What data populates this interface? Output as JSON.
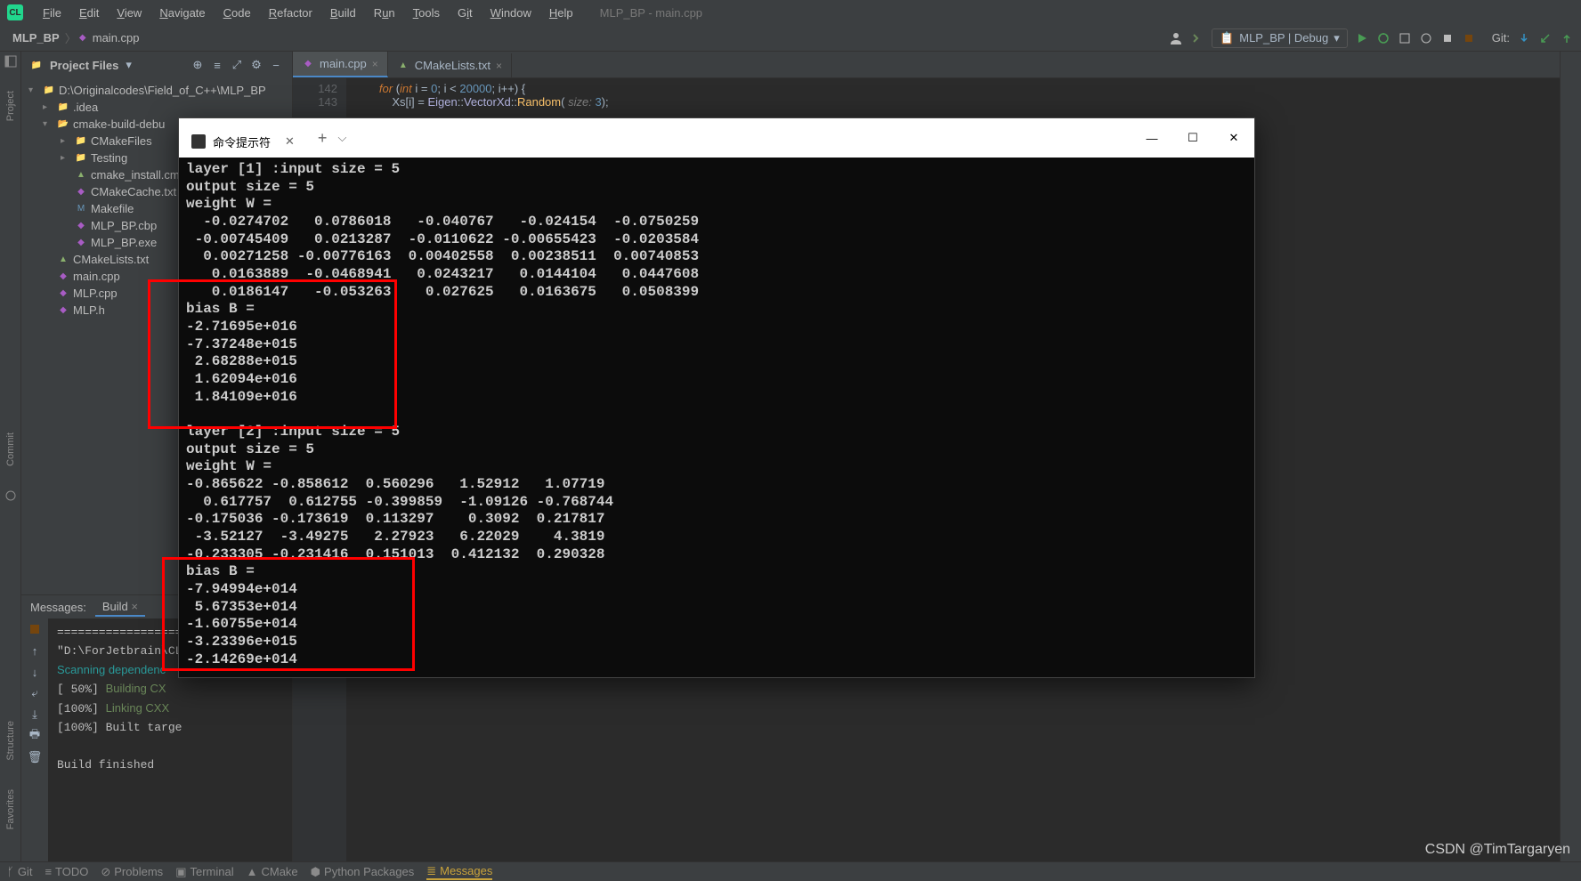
{
  "window": {
    "title": "MLP_BP - main.cpp"
  },
  "menu": {
    "file": "File",
    "edit": "Edit",
    "view": "View",
    "navigate": "Navigate",
    "code": "Code",
    "refactor": "Refactor",
    "build": "Build",
    "run": "Run",
    "tools": "Tools",
    "git": "Git",
    "window": "Window",
    "help": "Help"
  },
  "breadcrumb": {
    "project": "MLP_BP",
    "file": "main.cpp"
  },
  "runconfig": {
    "label": "MLP_BP | Debug"
  },
  "toolbar_right": {
    "git": "Git:"
  },
  "project_panel": {
    "title": "Project Files",
    "root": "D:\\Originalcodes\\Field_of_C++\\MLP_BP",
    "items": [
      {
        "name": ".idea",
        "type": "folder",
        "indent": 1,
        "arrow": "▸"
      },
      {
        "name": "cmake-build-debu",
        "type": "folder-o",
        "indent": 1,
        "arrow": "▾"
      },
      {
        "name": "CMakeFiles",
        "type": "folder",
        "indent": 2,
        "arrow": "▸"
      },
      {
        "name": "Testing",
        "type": "folder",
        "indent": 2,
        "arrow": "▸"
      },
      {
        "name": "cmake_install.cm",
        "type": "cmake",
        "indent": 2
      },
      {
        "name": "CMakeCache.txt",
        "type": "file-p",
        "indent": 2
      },
      {
        "name": "Makefile",
        "type": "file-b",
        "indent": 2
      },
      {
        "name": "MLP_BP.cbp",
        "type": "file-p",
        "indent": 2
      },
      {
        "name": "MLP_BP.exe",
        "type": "file-p",
        "indent": 2
      },
      {
        "name": "CMakeLists.txt",
        "type": "cmake",
        "indent": 1
      },
      {
        "name": "main.cpp",
        "type": "file-p",
        "indent": 1
      },
      {
        "name": "MLP.cpp",
        "type": "file-p",
        "indent": 1
      },
      {
        "name": "MLP.h",
        "type": "file-p",
        "indent": 1
      }
    ]
  },
  "editor": {
    "tabs": [
      {
        "name": "main.cpp",
        "active": true,
        "icon": "cpp"
      },
      {
        "name": "CMakeLists.txt",
        "active": false,
        "icon": "cmake"
      }
    ],
    "lines": [
      {
        "n": "142",
        "code": "for (int i = 0; i < 20000; i++) {"
      },
      {
        "n": "143",
        "code": "    Xs[i] = Eigen::VectorXd::Random( size: 3);"
      }
    ]
  },
  "messages": {
    "label": "Messages:",
    "tab": "Build",
    "lines": [
      "====================",
      "\"D:\\ForJetbrain\\CL",
      "Scanning dependenc",
      "[ 50%] Building CX",
      "[100%] Linking CXX",
      "[100%] Built targe",
      "",
      "Build finished"
    ]
  },
  "statusbar": {
    "git": "Git",
    "todo": "TODO",
    "problems": "Problems",
    "terminal": "Terminal",
    "cmake": "CMake",
    "python": "Python Packages",
    "messages": "Messages"
  },
  "terminal": {
    "tab_title": "命令提示符",
    "body": "layer [1] :input size = 5\noutput size = 5\nweight W =\n  -0.0274702   0.0786018   -0.040767   -0.024154  -0.0750259\n -0.00745409   0.0213287  -0.0110622 -0.00655423  -0.0203584\n  0.00271258 -0.00776163  0.00402558  0.00238511  0.00740853\n   0.0163889  -0.0468941   0.0243217   0.0144104   0.0447608\n   0.0186147   -0.053263    0.027625   0.0163675   0.0508399\nbias B =\n-2.71695e+016\n-7.37248e+015\n 2.68288e+015\n 1.62094e+016\n 1.84109e+016\n\nlayer [2] :input size = 5\noutput size = 5\nweight W =\n-0.865622 -0.858612  0.560296   1.52912   1.07719\n  0.617757  0.612755 -0.399859  -1.09126 -0.768744\n-0.175036 -0.173619  0.113297    0.3092  0.217817\n -3.52127  -3.49275   2.27923   6.22029    4.3819\n-0.233305 -0.231416  0.151013  0.412132  0.290328\nbias B =\n-7.94994e+014\n 5.67353e+014\n-1.60755e+014\n-3.23396e+015\n-2.14269e+014"
  },
  "watermark": "CSDN @TimTargaryen"
}
